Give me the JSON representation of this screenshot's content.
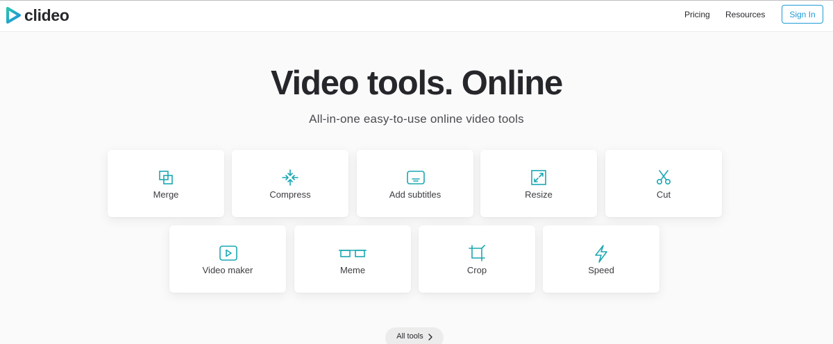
{
  "header": {
    "logo_text": "clideo",
    "nav": {
      "pricing": "Pricing",
      "resources": "Resources"
    },
    "signin_label": "Sign In"
  },
  "hero": {
    "title": "Video tools. Online",
    "subtitle": "All-in-one easy-to-use online video tools"
  },
  "tools": {
    "merge": {
      "label": "Merge",
      "icon": "merge-icon"
    },
    "compress": {
      "label": "Compress",
      "icon": "compress-icon"
    },
    "add_subtitles": {
      "label": "Add subtitles",
      "icon": "subtitles-icon"
    },
    "resize": {
      "label": "Resize",
      "icon": "resize-icon"
    },
    "cut": {
      "label": "Cut",
      "icon": "scissors-icon"
    },
    "video_maker": {
      "label": "Video maker",
      "icon": "play-icon"
    },
    "meme": {
      "label": "Meme",
      "icon": "glasses-icon"
    },
    "crop": {
      "label": "Crop",
      "icon": "crop-icon"
    },
    "speed": {
      "label": "Speed",
      "icon": "lightning-icon"
    }
  },
  "all_tools_label": "All tools",
  "colors": {
    "accent": "#1aa7b2",
    "brand_blue": "#1d9bd6",
    "text": "#26272b",
    "background": "#fafafa"
  }
}
